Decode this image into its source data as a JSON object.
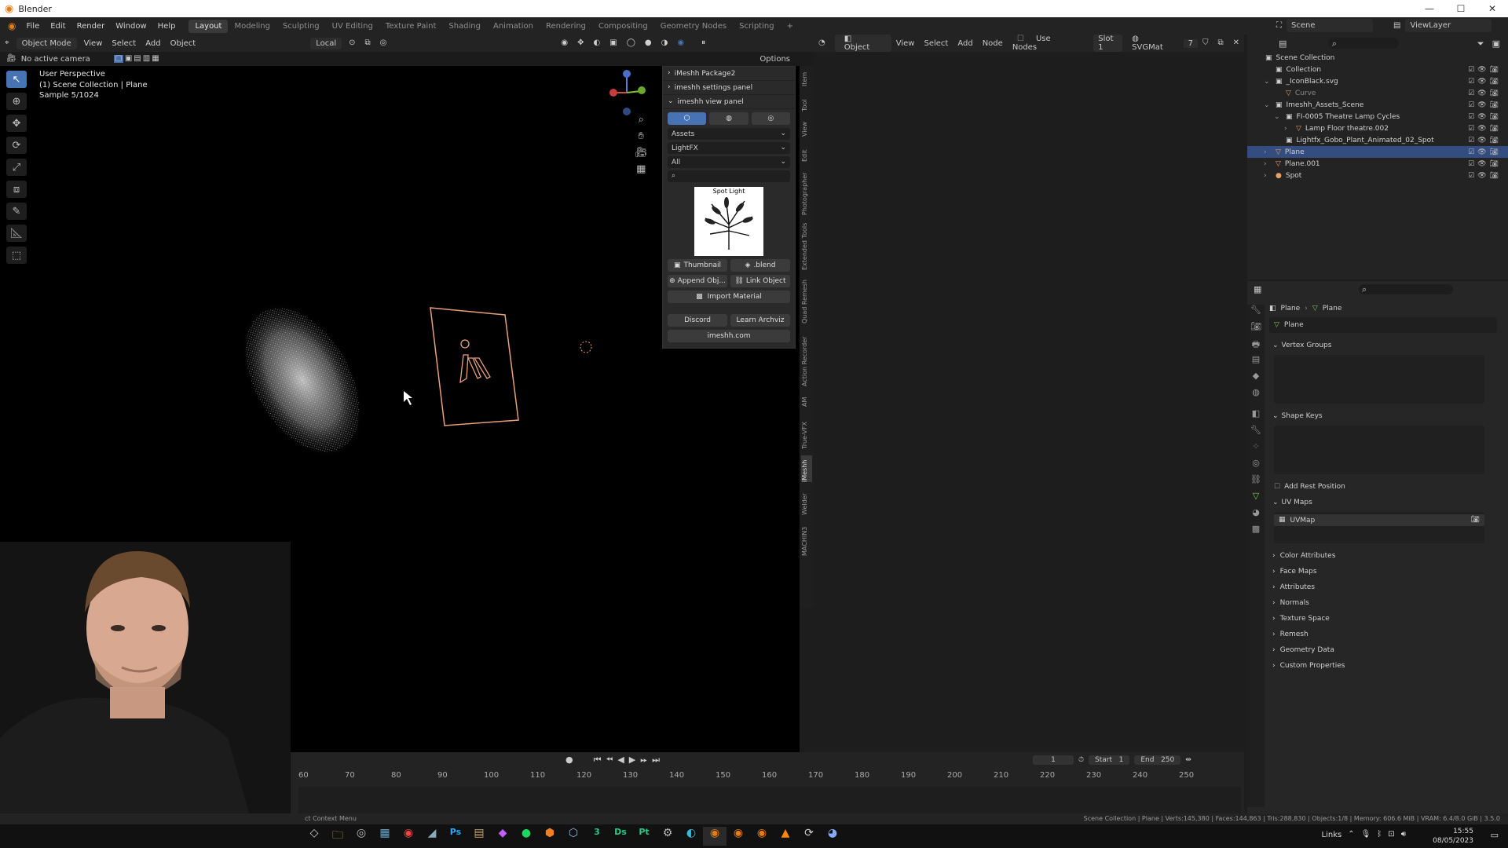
{
  "window": {
    "title": "Blender",
    "controls": [
      "—",
      "☐",
      "✕"
    ]
  },
  "menus": [
    "File",
    "Edit",
    "Render",
    "Window",
    "Help"
  ],
  "workspaces": [
    {
      "label": "Layout",
      "active": true
    },
    {
      "label": "Modeling"
    },
    {
      "label": "Sculpting"
    },
    {
      "label": "UV Editing"
    },
    {
      "label": "Texture Paint"
    },
    {
      "label": "Shading"
    },
    {
      "label": "Animation"
    },
    {
      "label": "Rendering"
    },
    {
      "label": "Compositing"
    },
    {
      "label": "Geometry Nodes"
    },
    {
      "label": "Scripting"
    }
  ],
  "top_right": {
    "scene": "Scene",
    "view_layer": "ViewLayer"
  },
  "viewport_header": {
    "mode": "Object Mode",
    "menus": [
      "View",
      "Select",
      "Add",
      "Object"
    ],
    "transform_orientation": "Local",
    "options": "Options"
  },
  "viewport_subheader": {
    "camera": "No active camera"
  },
  "viewport_info": {
    "line1": "User Perspective",
    "line2": "(1) Scene Collection | Plane",
    "line3": "Sample 5/1024"
  },
  "imeshh_panel": {
    "package": "iMeshh Package2",
    "settings": "imeshh settings panel",
    "view": "imeshh view panel",
    "category": "Assets",
    "subcategory": "LightFX",
    "filter": "All",
    "thumb_title": "Spot Light",
    "thumbnail": "Thumbnail",
    "blend": ".blend",
    "append": "Append Obj...",
    "link": "Link Object",
    "import_material": "Import Material",
    "discord": "Discord",
    "learn": "Learn Archviz",
    "site": "imeshh.com"
  },
  "side_tabs": [
    "Item",
    "Tool",
    "View",
    "Edit",
    "Photographer",
    "Extended Tools",
    "Quad Remesh",
    "Action Recorder",
    "AM",
    "True-VFX",
    "iMeshh",
    "Welder",
    "MACHIN3"
  ],
  "node_header": {
    "object": "Object",
    "menus": [
      "View",
      "Select",
      "Add",
      "Node"
    ],
    "use_nodes": "Use Nodes",
    "slot": "Slot 1",
    "material": "SVGMat",
    "users": "7"
  },
  "outliner": {
    "rows": [
      {
        "label": "Scene Collection",
        "indent": 0,
        "icon": "▣"
      },
      {
        "label": "Collection",
        "indent": 1,
        "icon": "▣"
      },
      {
        "label": "_IconBlack.svg",
        "indent": 1,
        "icon": "▣",
        "arrow": "⌄"
      },
      {
        "label": "Curve",
        "indent": 2,
        "icon": "▽",
        "dim": true
      },
      {
        "label": "Imeshh_Assets_Scene",
        "indent": 1,
        "icon": "▣",
        "arrow": "⌄"
      },
      {
        "label": "FI-0005 Theatre Lamp Cycles",
        "indent": 2,
        "icon": "▣",
        "arrow": "⌄"
      },
      {
        "label": "Lamp Floor theatre.002",
        "indent": 3,
        "icon": "▽",
        "arrow": "›"
      },
      {
        "label": "Lightfx_Gobo_Plant_Animated_02_Spot",
        "indent": 2,
        "icon": "▣"
      },
      {
        "label": "Plane",
        "indent": 1,
        "icon": "▽",
        "arrow": "›",
        "selected": true
      },
      {
        "label": "Plane.001",
        "indent": 1,
        "icon": "▽",
        "arrow": "›"
      },
      {
        "label": "Spot",
        "indent": 1,
        "icon": "●",
        "arrow": "›"
      }
    ]
  },
  "properties": {
    "breadcrumb_object": "Plane",
    "breadcrumb_data": "Plane",
    "data_name": "Plane",
    "vertex_groups": "Vertex Groups",
    "shape_keys": "Shape Keys",
    "add_rest_position": "Add Rest Position",
    "uv_maps": "UV Maps",
    "uv_map_name": "UVMap",
    "collapsed": [
      "Color Attributes",
      "Face Maps",
      "Attributes",
      "Normals",
      "Texture Space",
      "Remesh",
      "Geometry Data",
      "Custom Properties"
    ]
  },
  "timeline": {
    "ticks": [
      "60",
      "70",
      "80",
      "90",
      "100",
      "110",
      "120",
      "130",
      "140",
      "150",
      "160",
      "170",
      "180",
      "190",
      "200",
      "210",
      "220",
      "230",
      "240",
      "250"
    ],
    "current_frame": "1",
    "start_label": "Start",
    "start": "1",
    "end_label": "End",
    "end": "250"
  },
  "statusbar": {
    "left": "ct Context Menu",
    "right": "Scene Collection | Plane | Verts:145,380 | Faces:144,863 | Tris:288,830 | Objects:1/8 | Memory: 606.6 MiB | VRAM: 6.4/8.0 GiB | 3.5.0"
  },
  "taskbar": {
    "tray_label": "Links",
    "time": "15:55",
    "date": "08/05/2023"
  },
  "colors": {
    "accent": "#4772b3",
    "selected": "#334d80",
    "orange": "#e87d0d",
    "lamp_outline": "#e8a07a"
  }
}
